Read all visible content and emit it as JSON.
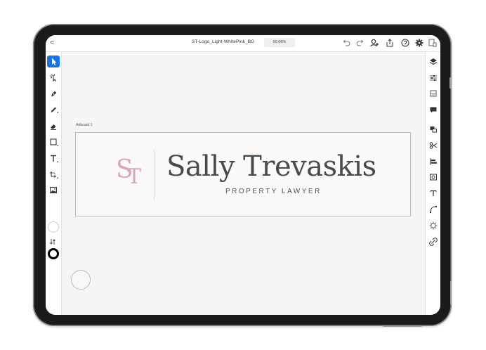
{
  "topbar": {
    "back_icon": "chevron-left-icon",
    "back_label": "<",
    "document_title": "ST-Logo_Light-WhitePink_BG",
    "zoom_level": "50.06%",
    "icons": [
      "undo-icon",
      "redo-icon",
      "share-user-icon",
      "export-icon",
      "help-icon",
      "settings-icon",
      "devices-icon"
    ]
  },
  "left_toolbar": {
    "tools": [
      "select-tool-icon",
      "auto-select-tool-icon",
      "pen-tool-icon",
      "pencil-tool-icon",
      "eraser-tool-icon",
      "shape-tool-icon",
      "text-tool-icon",
      "transform-tool-icon",
      "image-tool-icon"
    ],
    "active_tool": "select-tool-icon",
    "fill_color": "#ffffff",
    "stroke_color": "#000000"
  },
  "right_toolbar": {
    "panels": [
      "layers-icon",
      "properties-icon",
      "libraries-icon",
      "comments-icon",
      "arrange-icon",
      "scissors-icon",
      "align-icon",
      "image-adjust-icon",
      "type-icon",
      "path-icon",
      "gear-pattern-icon",
      "link-icon"
    ]
  },
  "canvas": {
    "artboard_label": "Artboard 1",
    "logo": {
      "monogram_s": "S",
      "monogram_t": "T",
      "name": "Sally Trevaskis",
      "subtitle": "PROPERTY LAWYER",
      "monogram_color": "#d8a9b4",
      "text_color": "#4a4a4a"
    }
  },
  "colors": {
    "accent": "#1473e6",
    "canvas_bg": "#f4f5f4",
    "device_frame": "#1b1b1d"
  }
}
